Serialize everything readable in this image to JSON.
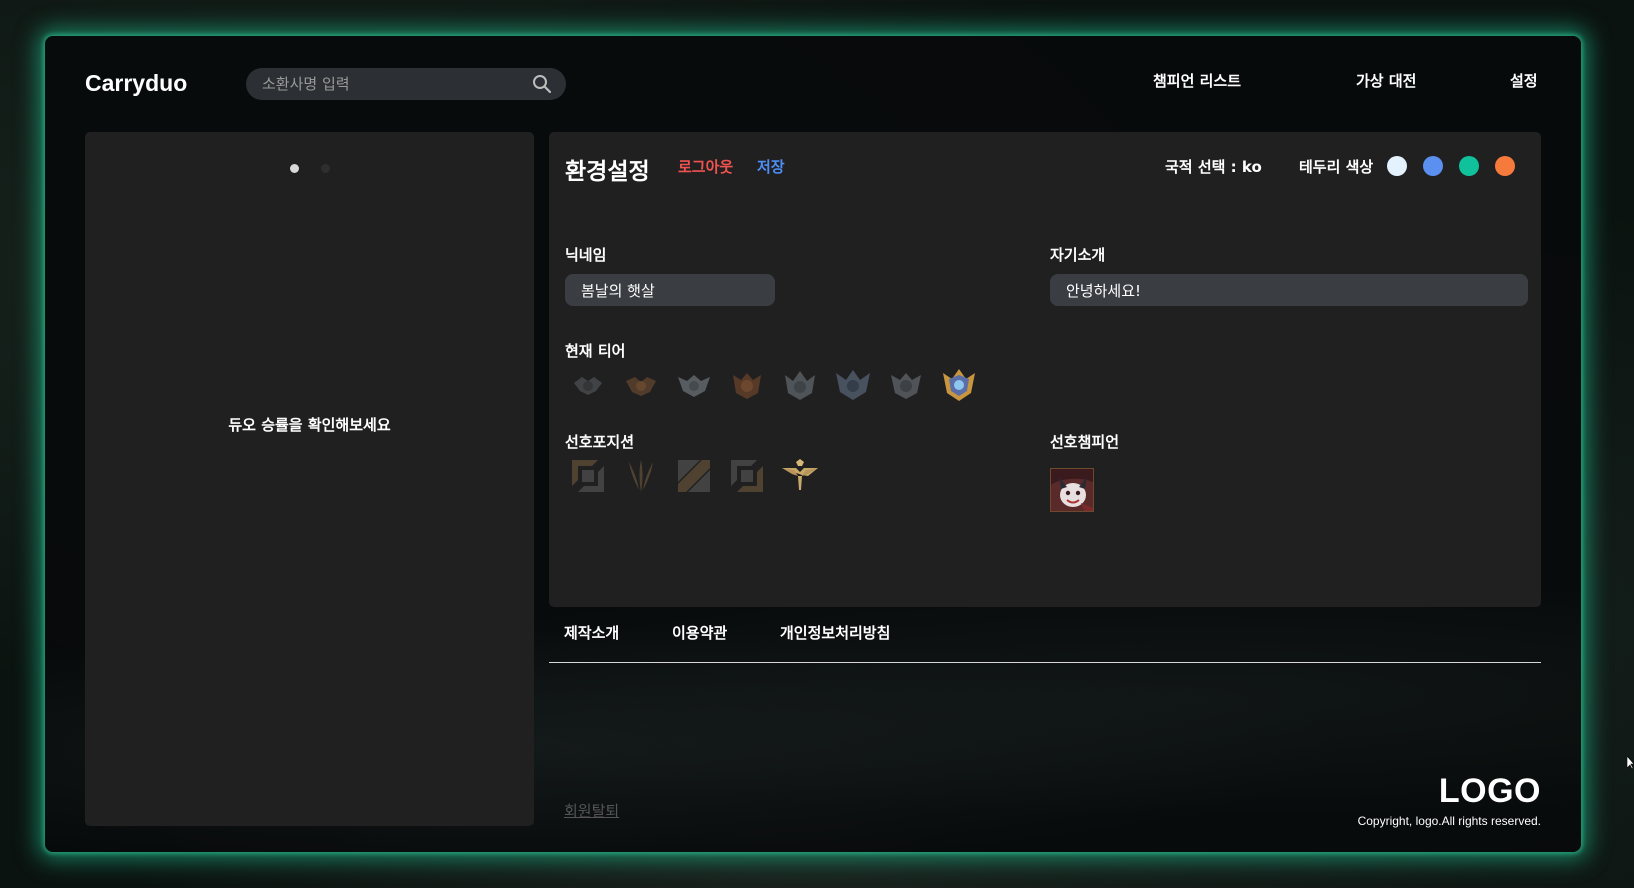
{
  "header": {
    "brand": "Carryduo",
    "search_placeholder": "소환사명 입력",
    "nav": [
      "챔피언 리스트",
      "가상 대전",
      "설정"
    ]
  },
  "left_panel": {
    "carousel_dots": 2,
    "active_dot": 0,
    "message": "듀오 승률을 확인해보세요"
  },
  "settings": {
    "title": "환경설정",
    "logout_label": "로그아웃",
    "save_label": "저장",
    "country_label": "국적 선택 : ko",
    "border_color_label": "테두리 색상",
    "border_colors": [
      "#e3f2fd",
      "#5b8ff0",
      "#10c29b",
      "#f57a3c"
    ],
    "nickname_label": "닉네임",
    "nickname_value": "봄날의 햇살",
    "bio_label": "자기소개",
    "bio_value": "안녕하세요!",
    "tier_label": "현재 티어",
    "tiers": [
      "iron-emblem-icon",
      "bronze-emblem-icon",
      "silver-emblem-icon",
      "gold-emblem-icon",
      "platinum-emblem-icon",
      "diamond-emblem-icon",
      "master-emblem-icon",
      "challenger-emblem-icon"
    ],
    "position_label": "선호포지션",
    "positions": [
      "top-lane-icon",
      "jungle-icon",
      "mid-lane-icon",
      "bottom-lane-icon",
      "support-icon"
    ],
    "champion_label": "선호챔피언",
    "champion_icon": "champion-portrait-icon"
  },
  "footer": {
    "links": [
      "제작소개",
      "이용약관",
      "개인정보처리방침"
    ],
    "withdraw_label": "회원탈퇴",
    "logo_text": "LOGO",
    "copyright": "Copyright, logo.All rights reserved."
  },
  "colors": {
    "glow": "#20c896",
    "panel": "#202020",
    "logout": "#ef5350",
    "save": "#4d8ef7"
  }
}
